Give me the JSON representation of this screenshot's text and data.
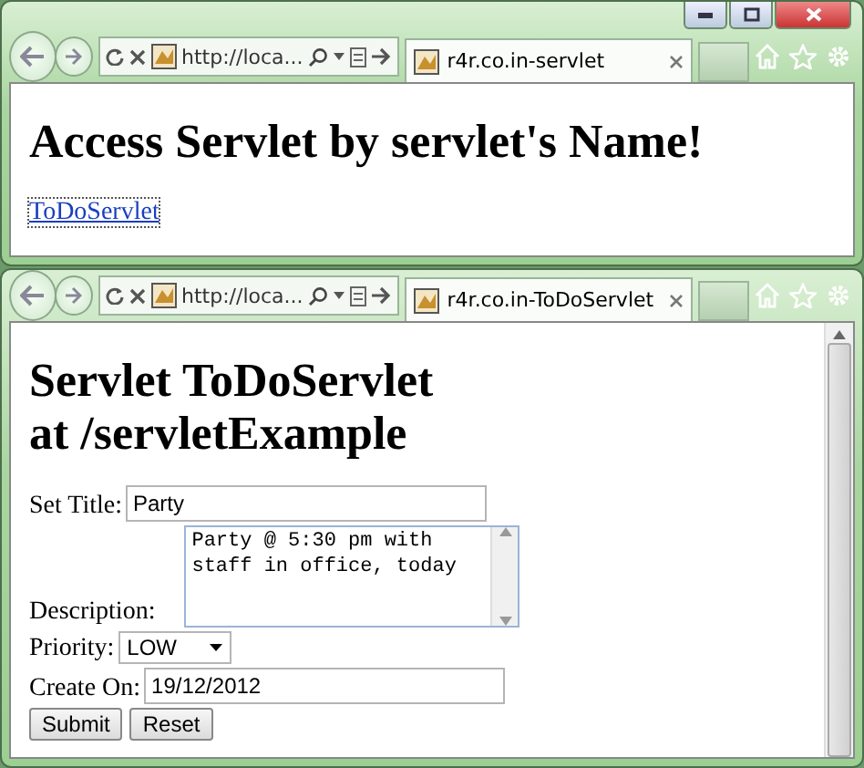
{
  "windows": [
    {
      "caption_buttons": true,
      "address": "http://loca...",
      "tab_title": "r4r.co.in-servlet",
      "page": {
        "kind": "link_page",
        "heading_lines": [
          "Access Servlet by servlet's Name!"
        ],
        "link": "ToDoServlet"
      }
    },
    {
      "caption_buttons": false,
      "address": "http://loca...",
      "tab_title": "r4r.co.in-ToDoServlet",
      "page": {
        "kind": "form_page",
        "heading_lines": [
          "Servlet ToDoServlet",
          "at /servletExample"
        ],
        "fields": [
          {
            "kind": "text",
            "label": "Set Title:",
            "value": "Party"
          },
          {
            "kind": "textarea",
            "label": "Description:",
            "value": "Party @ 5:30 pm with staff in office, today"
          },
          {
            "kind": "select",
            "label": "Priority:",
            "value": "LOW"
          },
          {
            "kind": "text",
            "label": "Create On:",
            "value": "19/12/2012"
          }
        ],
        "buttons": [
          "Submit",
          "Reset"
        ]
      }
    }
  ]
}
